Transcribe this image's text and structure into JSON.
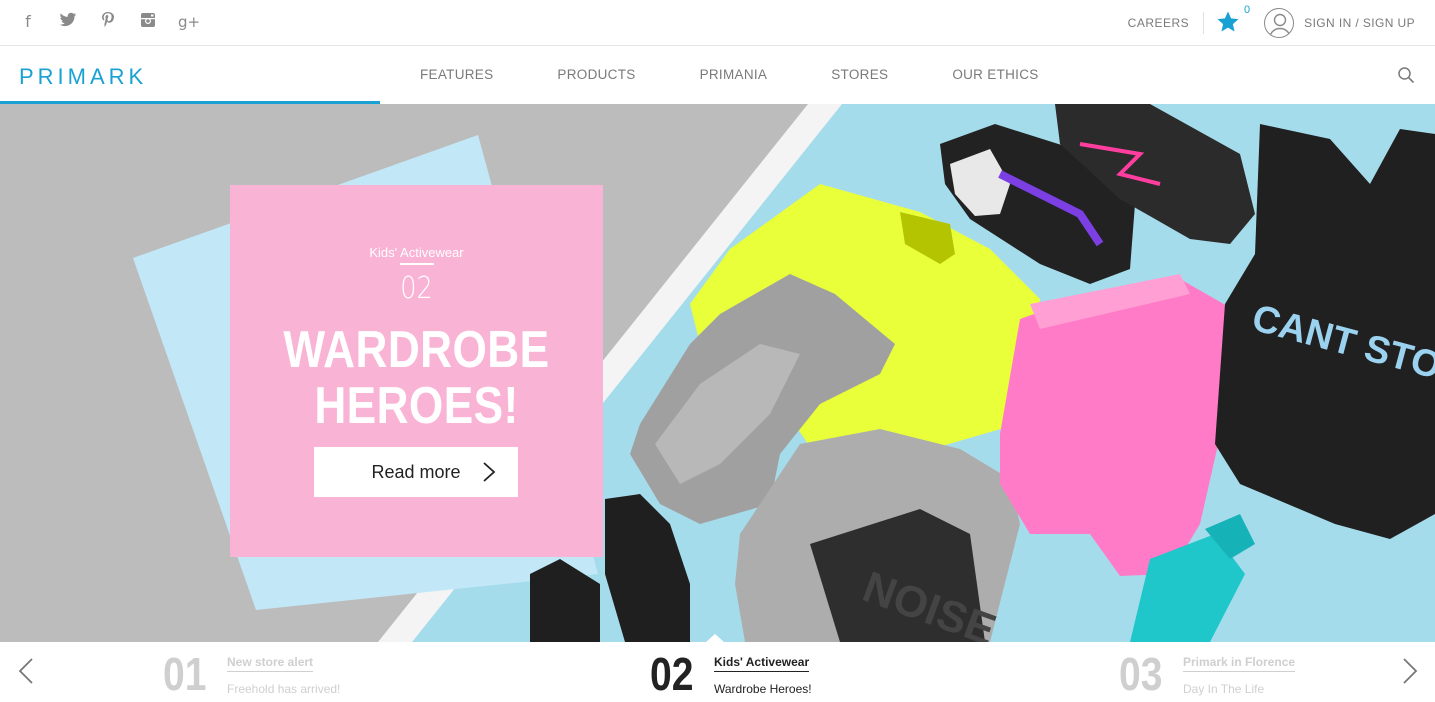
{
  "social": [
    "facebook-icon",
    "twitter-icon",
    "pinterest-icon",
    "instagram-icon",
    "google-plus-icon"
  ],
  "header": {
    "careers": "CAREERS",
    "wishlist_count": "0",
    "signin": "SIGN IN / SIGN UP"
  },
  "nav": {
    "logo": "PRIMARK",
    "items": [
      "FEATURES",
      "PRODUCTS",
      "PRIMANIA",
      "STORES",
      "OUR ETHICS"
    ],
    "progress": 0.265
  },
  "hero": {
    "category": "Kids' Activewear",
    "number": "02",
    "title_line1": "WARDROBE",
    "title_line2": "HEROES!",
    "cta": "Read more",
    "shirt_text": "CANT STOP ME",
    "sweat_text": "NOISE"
  },
  "carousel": {
    "slides": [
      {
        "number": "01",
        "category": "New store alert",
        "subtitle": "Freehold has arrived!"
      },
      {
        "number": "02",
        "category": "Kids' Activewear",
        "subtitle": "Wardrobe Heroes!"
      },
      {
        "number": "03",
        "category": "Primark in Florence",
        "subtitle": "Day In The Life"
      }
    ]
  },
  "colors": {
    "accent": "#1aa1d4",
    "promo_pink": "#f9b3d4"
  }
}
